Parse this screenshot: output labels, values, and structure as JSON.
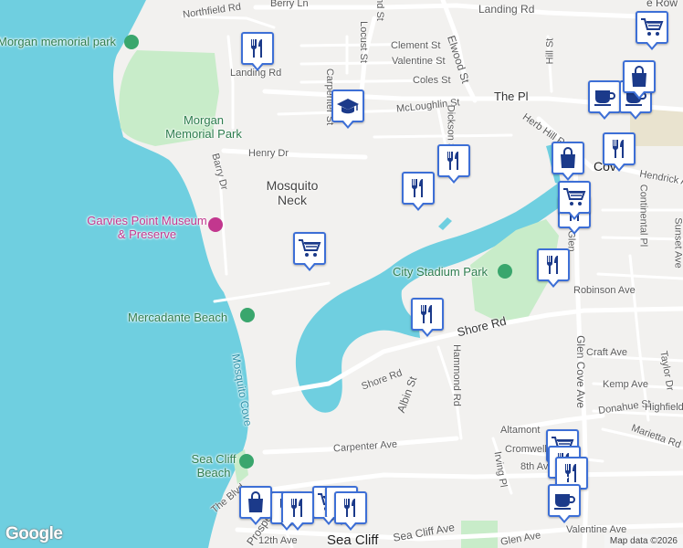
{
  "map": {
    "colors": {
      "water": "#6fcfe0",
      "land": "#f2f1ef",
      "park": "#c8ecc9",
      "road": "#ffffff",
      "road_edge": "#d9d9d9",
      "pin_border": "#3d6fd6"
    },
    "streets": [
      "Northfield Rd",
      "Berry Ln",
      "Landing Rd",
      "Elwood St",
      "Locust St",
      "Clement St",
      "Valentine St",
      "Coles St",
      "McLoughlin St",
      "The Pl",
      "Hill St",
      "Carpenter St",
      "Dickson St",
      "Herb Hill Rd",
      "Henry Dr",
      "Barry Dr",
      "Hendrick Ave",
      "Continental Pl",
      "Glen Cove Ave",
      "Sunset Ave",
      "Robinson Ave",
      "Shore Rd",
      "Hammond Rd",
      "Craft Ave",
      "Kemp Ave",
      "Taylor Dr",
      "Donahue St",
      "Highfield",
      "Albin St",
      "Altamont",
      "Marietta Rd",
      "Cromwell",
      "Irving Pl",
      "8th Ave",
      "Carpenter Ave",
      "The Blvd",
      "Prospect Ave",
      "12th Ave",
      "Sea Cliff Ave",
      "Glen Ave",
      "Valentine Ave",
      "Landing Rd"
    ],
    "places": {
      "morgan_park_top": "Morgan memorial park",
      "morgan_park": "Morgan Memorial Park",
      "mosquito_neck": "Mosquito Neck",
      "garvies": "Garvies Point Museum & Preserve",
      "city_stadium": "City Stadium Park",
      "mercadante": "Mercadante Beach",
      "mosquito_cove": "Mosquito Cove",
      "sea_cliff_beach": "Sea Cliff Beach",
      "sea_cliff": "Sea Cliff",
      "glen_cove_partial": "Cov",
      "glen_cove_prefix": "Glen",
      "row_partial": "e Row"
    },
    "pins": [
      {
        "type": "restaurant",
        "icon": "fork-knife-icon"
      },
      {
        "type": "school",
        "icon": "graduation-cap-icon"
      },
      {
        "type": "restaurant",
        "icon": "fork-knife-icon"
      },
      {
        "type": "restaurant",
        "icon": "fork-knife-icon"
      },
      {
        "type": "shopping",
        "icon": "shopping-cart-icon"
      },
      {
        "type": "restaurant",
        "icon": "fork-knife-icon"
      },
      {
        "type": "restaurant",
        "icon": "fork-knife-icon"
      },
      {
        "type": "shopping",
        "icon": "shopping-cart-icon"
      },
      {
        "type": "shopping",
        "icon": "shopping-bag-icon"
      },
      {
        "type": "restaurant",
        "icon": "fork-knife-icon"
      },
      {
        "type": "cafe",
        "icon": "coffee-cup-icon"
      },
      {
        "type": "cafe",
        "icon": "coffee-cup-icon"
      },
      {
        "type": "shopping",
        "icon": "shopping-cart-icon"
      },
      {
        "type": "shopping",
        "icon": "shopping-bag-icon"
      },
      {
        "type": "restaurant",
        "icon": "fork-knife-icon"
      },
      {
        "type": "restaurant",
        "icon": "fork-knife-icon"
      },
      {
        "type": "shopping",
        "icon": "shopping-cart-icon"
      },
      {
        "type": "shopping",
        "icon": "shopping-bag-icon"
      },
      {
        "type": "restaurant",
        "icon": "fork-knife-icon"
      },
      {
        "type": "shopping",
        "icon": "shopping-cart-icon"
      },
      {
        "type": "restaurant",
        "icon": "fork-knife-icon"
      },
      {
        "type": "restaurant",
        "icon": "fork-knife-icon"
      },
      {
        "type": "shopping",
        "icon": "shopping-bag-icon"
      },
      {
        "type": "cafe",
        "icon": "coffee-cup-icon"
      },
      {
        "type": "restaurant",
        "icon": "fork-knife-icon"
      }
    ],
    "attribution": "Map data ©2026",
    "logo": "Google"
  }
}
